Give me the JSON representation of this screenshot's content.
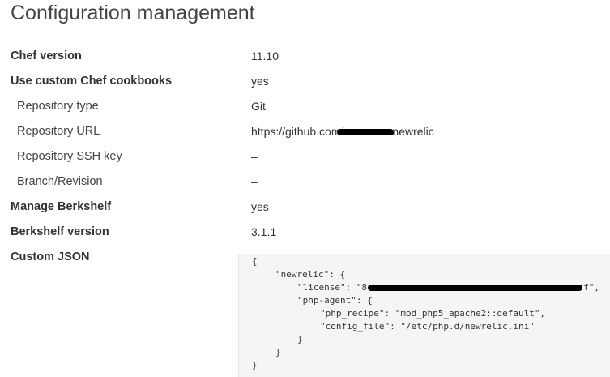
{
  "page": {
    "title": "Configuration management"
  },
  "rows": [
    {
      "label": "Chef version",
      "value": "11.10"
    },
    {
      "label": "Use custom Chef cookbooks",
      "value": "yes"
    },
    {
      "label": "Repository type",
      "value": "Git"
    },
    {
      "label": "Repository URL",
      "value_prefix": "https://github.com/",
      "value_suffix": "newrelic"
    },
    {
      "label": "Repository SSH key",
      "value": "–"
    },
    {
      "label": "Branch/Revision",
      "value": "–"
    },
    {
      "label": "Manage Berkshelf",
      "value": "yes"
    },
    {
      "label": "Berkshelf version",
      "value": "3.1.1"
    },
    {
      "label": "Custom JSON"
    }
  ],
  "custom_json": {
    "line1": "{",
    "line2": "\"newrelic\": {",
    "line3_prefix": "\"license\": \"8",
    "line3_suffix": "f\",",
    "line4": "\"php-agent\": {",
    "line5": "\"php_recipe\": \"mod_php5_apache2::default\",",
    "line6": "\"config_file\": \"/etc/php.d/newrelic.ini\"",
    "line7": "}",
    "line8": "}",
    "line9": "}"
  }
}
